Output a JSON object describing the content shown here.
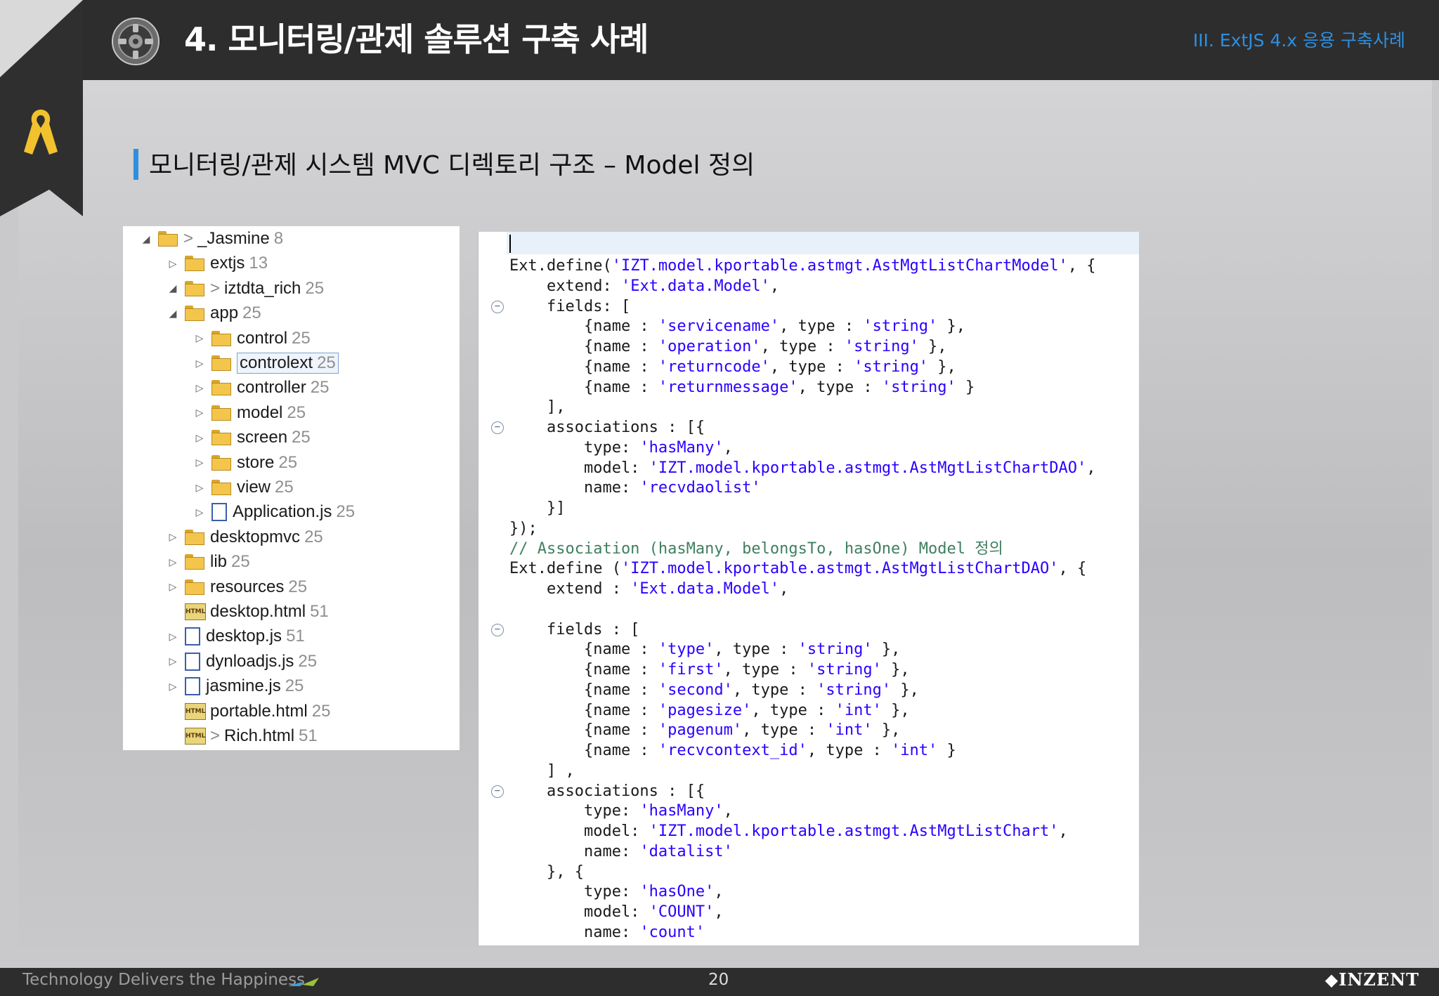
{
  "header": {
    "title": "4. 모니터링/관제 솔루션 구축 사례",
    "section": "III. ExtJS 4.x 응용 구축사례"
  },
  "subtitle": "모니터링/관제 시스템  MVC  디렉토리 구조  –  Model 정의",
  "tree": [
    {
      "text": "_Jasmine",
      "count": "8",
      "prefix": "> ",
      "icon": "folder",
      "twisty": "◢",
      "indent": 0
    },
    {
      "text": "extjs",
      "count": "13",
      "prefix": "",
      "icon": "folder",
      "twisty": "▷",
      "indent": 1
    },
    {
      "text": "iztdta_rich",
      "count": "25",
      "prefix": "> ",
      "icon": "folder",
      "twisty": "◢",
      "indent": 1
    },
    {
      "text": "app",
      "count": "25",
      "prefix": "",
      "icon": "folder",
      "twisty": "◢",
      "indent": 2
    },
    {
      "text": "control",
      "count": "25",
      "prefix": "",
      "icon": "folder",
      "twisty": "▷",
      "indent": 3
    },
    {
      "text": "controlext",
      "count": "25",
      "prefix": "",
      "icon": "folder",
      "twisty": "▷",
      "indent": 3,
      "selected": true
    },
    {
      "text": "controller",
      "count": "25",
      "prefix": "",
      "icon": "folder",
      "twisty": "▷",
      "indent": 3
    },
    {
      "text": "model",
      "count": "25",
      "prefix": "",
      "icon": "folder",
      "twisty": "▷",
      "indent": 3
    },
    {
      "text": "screen",
      "count": "25",
      "prefix": "",
      "icon": "folder",
      "twisty": "▷",
      "indent": 3
    },
    {
      "text": "store",
      "count": "25",
      "prefix": "",
      "icon": "folder",
      "twisty": "▷",
      "indent": 3
    },
    {
      "text": "view",
      "count": "25",
      "prefix": "",
      "icon": "folder",
      "twisty": "▷",
      "indent": 3
    },
    {
      "text": "Application.js",
      "count": "25",
      "prefix": "",
      "icon": "file",
      "twisty": "▷",
      "indent": 3
    },
    {
      "text": "desktopmvc",
      "count": "25",
      "prefix": "",
      "icon": "folder",
      "twisty": "▷",
      "indent": 2
    },
    {
      "text": "lib",
      "count": "25",
      "prefix": "",
      "icon": "folder",
      "twisty": "▷",
      "indent": 2
    },
    {
      "text": "resources",
      "count": "25",
      "prefix": "",
      "icon": "folder",
      "twisty": "▷",
      "indent": 2
    },
    {
      "text": "desktop.html",
      "count": "51",
      "prefix": "",
      "icon": "html",
      "twisty": "",
      "indent": 2
    },
    {
      "text": "desktop.js",
      "count": "51",
      "prefix": "",
      "icon": "file",
      "twisty": "▷",
      "indent": 2
    },
    {
      "text": "dynloadjs.js",
      "count": "25",
      "prefix": "",
      "icon": "file",
      "twisty": "▷",
      "indent": 2
    },
    {
      "text": "jasmine.js",
      "count": "25",
      "prefix": "",
      "icon": "file",
      "twisty": "▷",
      "indent": 2
    },
    {
      "text": "portable.html",
      "count": "25",
      "prefix": "",
      "icon": "html",
      "twisty": "",
      "indent": 2
    },
    {
      "text": "Rich.html",
      "count": "51",
      "prefix": "> ",
      "icon": "html",
      "twisty": "",
      "indent": 2
    }
  ],
  "code": [
    {
      "segs": [
        [
          "",
          ""
        ]
      ]
    },
    {
      "segs": [
        [
          "",
          "Ext.define("
        ],
        [
          "s",
          "'IZT.model.kportable.astmgt.AstMgtListChartModel'"
        ],
        [
          "",
          ", {"
        ]
      ]
    },
    {
      "segs": [
        [
          "",
          "    extend: "
        ],
        [
          "s",
          "'Ext.data.Model'"
        ],
        [
          "",
          ","
        ]
      ]
    },
    {
      "fold": true,
      "segs": [
        [
          "",
          "    fields: ["
        ]
      ]
    },
    {
      "segs": [
        [
          "",
          "        {name : "
        ],
        [
          "s",
          "'servicename'"
        ],
        [
          "",
          ", type : "
        ],
        [
          "s",
          "'string'"
        ],
        [
          "",
          " },"
        ]
      ]
    },
    {
      "segs": [
        [
          "",
          "        {name : "
        ],
        [
          "s",
          "'operation'"
        ],
        [
          "",
          ", type : "
        ],
        [
          "s",
          "'string'"
        ],
        [
          "",
          " },"
        ]
      ]
    },
    {
      "segs": [
        [
          "",
          "        {name : "
        ],
        [
          "s",
          "'returncode'"
        ],
        [
          "",
          ", type : "
        ],
        [
          "s",
          "'string'"
        ],
        [
          "",
          " },"
        ]
      ]
    },
    {
      "segs": [
        [
          "",
          "        {name : "
        ],
        [
          "s",
          "'returnmessage'"
        ],
        [
          "",
          ", type : "
        ],
        [
          "s",
          "'string'"
        ],
        [
          "",
          " }"
        ]
      ]
    },
    {
      "segs": [
        [
          "",
          "    ],"
        ]
      ]
    },
    {
      "fold": true,
      "segs": [
        [
          "",
          "    associations : [{"
        ]
      ]
    },
    {
      "segs": [
        [
          "",
          "        type: "
        ],
        [
          "s",
          "'hasMany'"
        ],
        [
          "",
          ","
        ]
      ]
    },
    {
      "segs": [
        [
          "",
          "        model: "
        ],
        [
          "s",
          "'IZT.model.kportable.astmgt.AstMgtListChartDAO'"
        ],
        [
          "",
          ","
        ]
      ]
    },
    {
      "segs": [
        [
          "",
          "        name: "
        ],
        [
          "s",
          "'recvdaolist'"
        ]
      ]
    },
    {
      "segs": [
        [
          "",
          "    }]"
        ]
      ]
    },
    {
      "segs": [
        [
          "",
          "});"
        ]
      ]
    },
    {
      "segs": [
        [
          "c",
          "// Association (hasMany, belongsTo, hasOne) Model 정의"
        ]
      ]
    },
    {
      "segs": [
        [
          "",
          "Ext.define ("
        ],
        [
          "s",
          "'IZT.model.kportable.astmgt.AstMgtListChartDAO'"
        ],
        [
          "",
          ", {"
        ]
      ]
    },
    {
      "segs": [
        [
          "",
          "    extend : "
        ],
        [
          "s",
          "'Ext.data.Model'"
        ],
        [
          "",
          ","
        ]
      ]
    },
    {
      "segs": [
        [
          "",
          ""
        ]
      ]
    },
    {
      "fold": true,
      "segs": [
        [
          "",
          "    fields : ["
        ]
      ]
    },
    {
      "segs": [
        [
          "",
          "        {name : "
        ],
        [
          "s",
          "'type'"
        ],
        [
          "",
          ", type : "
        ],
        [
          "s",
          "'string'"
        ],
        [
          "",
          " },"
        ]
      ]
    },
    {
      "segs": [
        [
          "",
          "        {name : "
        ],
        [
          "s",
          "'first'"
        ],
        [
          "",
          ", type : "
        ],
        [
          "s",
          "'string'"
        ],
        [
          "",
          " },"
        ]
      ]
    },
    {
      "segs": [
        [
          "",
          "        {name : "
        ],
        [
          "s",
          "'second'"
        ],
        [
          "",
          ", type : "
        ],
        [
          "s",
          "'string'"
        ],
        [
          "",
          " },"
        ]
      ]
    },
    {
      "segs": [
        [
          "",
          "        {name : "
        ],
        [
          "s",
          "'pagesize'"
        ],
        [
          "",
          ", type : "
        ],
        [
          "s",
          "'int'"
        ],
        [
          "",
          " },"
        ]
      ]
    },
    {
      "segs": [
        [
          "",
          "        {name : "
        ],
        [
          "s",
          "'pagenum'"
        ],
        [
          "",
          ", type : "
        ],
        [
          "s",
          "'int'"
        ],
        [
          "",
          " },"
        ]
      ]
    },
    {
      "segs": [
        [
          "",
          "        {name : "
        ],
        [
          "s",
          "'recvcontext_id'"
        ],
        [
          "",
          ", type : "
        ],
        [
          "s",
          "'int'"
        ],
        [
          "",
          " }"
        ]
      ]
    },
    {
      "segs": [
        [
          "",
          "    ] ,"
        ]
      ]
    },
    {
      "fold": true,
      "segs": [
        [
          "",
          "    associations : [{"
        ]
      ]
    },
    {
      "segs": [
        [
          "",
          "        type: "
        ],
        [
          "s",
          "'hasMany'"
        ],
        [
          "",
          ","
        ]
      ]
    },
    {
      "segs": [
        [
          "",
          "        model: "
        ],
        [
          "s",
          "'IZT.model.kportable.astmgt.AstMgtListChart'"
        ],
        [
          "",
          ","
        ]
      ]
    },
    {
      "segs": [
        [
          "",
          "        name: "
        ],
        [
          "s",
          "'datalist'"
        ]
      ]
    },
    {
      "segs": [
        [
          "",
          "    }, {"
        ]
      ]
    },
    {
      "segs": [
        [
          "",
          "        type: "
        ],
        [
          "s",
          "'hasOne'"
        ],
        [
          "",
          ","
        ]
      ]
    },
    {
      "segs": [
        [
          "",
          "        model: "
        ],
        [
          "s",
          "'COUNT'"
        ],
        [
          "",
          ","
        ]
      ]
    },
    {
      "segs": [
        [
          "",
          "        name: "
        ],
        [
          "s",
          "'count'"
        ]
      ]
    }
  ],
  "footer": {
    "tagline": "Technology Delivers the Happiness",
    "page": "20",
    "logo": "INZENT"
  },
  "colors": {
    "accent": "#2e8fe0",
    "header_bg": "#2d2d2d",
    "ribbon": "#f2c12e"
  }
}
